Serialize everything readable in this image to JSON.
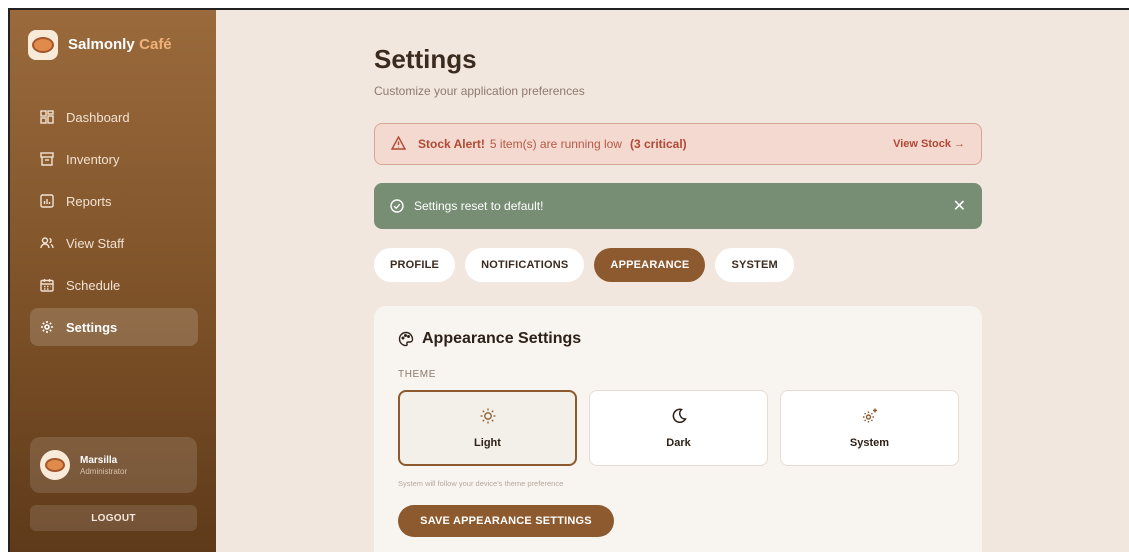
{
  "brand": {
    "name": "Salmonly",
    "accent": "Café"
  },
  "sidebar": {
    "items": [
      {
        "label": "Dashboard",
        "icon": "dashboard-icon"
      },
      {
        "label": "Inventory",
        "icon": "archive-icon"
      },
      {
        "label": "Reports",
        "icon": "chart-icon"
      },
      {
        "label": "View Staff",
        "icon": "users-icon"
      },
      {
        "label": "Schedule",
        "icon": "calendar-icon"
      },
      {
        "label": "Settings",
        "icon": "gear-icon",
        "active": true
      }
    ],
    "user": {
      "name": "Marsilla",
      "role": "Administrator"
    },
    "logout_label": "LOGOUT"
  },
  "header": {
    "title": "Settings",
    "subtitle": "Customize your application preferences"
  },
  "alert": {
    "title": "Stock Alert!",
    "message": "5 item(s) are running low",
    "critical": "(3 critical)",
    "link": "View Stock →"
  },
  "toast": {
    "message": "Settings reset to default!",
    "close": "✕"
  },
  "tabs": [
    {
      "label": "PROFILE"
    },
    {
      "label": "NOTIFICATIONS"
    },
    {
      "label": "APPEARANCE",
      "active": true
    },
    {
      "label": "SYSTEM"
    }
  ],
  "appearance": {
    "title": "Appearance Settings",
    "theme_label": "THEME",
    "options": [
      {
        "label": "Light",
        "icon": "sun-icon",
        "selected": true
      },
      {
        "label": "Dark",
        "icon": "moon-icon"
      },
      {
        "label": "System",
        "icon": "gear-sparkle-icon"
      }
    ],
    "hint": "System will follow your device's theme preference",
    "save_label": "SAVE APPEARANCE SETTINGS"
  },
  "colors": {
    "accent": "#8c5a2e",
    "sidebar_top": "#9a6a3c",
    "sidebar_bottom": "#5e3a1a",
    "alert_bg": "#f3d9d0",
    "alert_text": "#b04a34",
    "toast_bg": "#778e75",
    "page_bg": "#f2e7df"
  }
}
